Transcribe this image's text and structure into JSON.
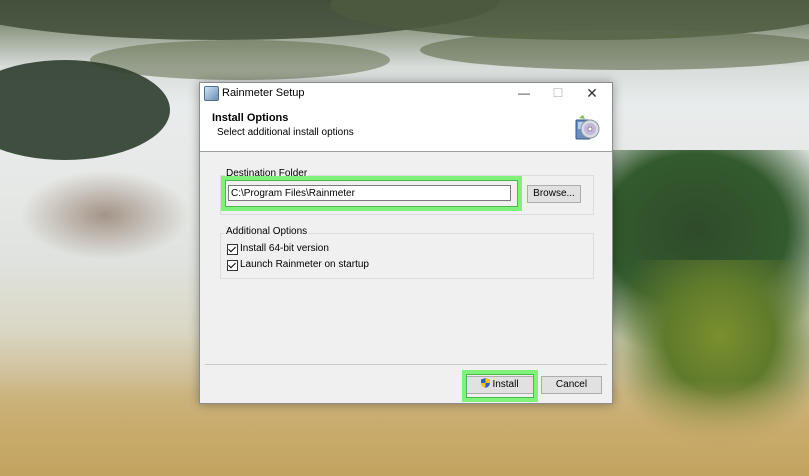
{
  "window": {
    "title": "Rainmeter Setup",
    "min_glyph": "—",
    "max_glyph": "☐",
    "close_glyph": "✕"
  },
  "header": {
    "title": "Install Options",
    "subtitle": "Select additional install options",
    "icon": "installer-disc-icon"
  },
  "destination": {
    "group_label": "Destination Folder",
    "path_value": "C:\\Program Files\\Rainmeter",
    "browse_label": "Browse..."
  },
  "options": {
    "group_label": "Additional Options",
    "items": [
      {
        "label": "Install 64-bit version",
        "checked": true
      },
      {
        "label": "Launch Rainmeter on startup",
        "checked": true
      }
    ]
  },
  "footer": {
    "install_label": "Install",
    "cancel_label": "Cancel"
  },
  "colors": {
    "highlight": "#7ef27a",
    "dialog_bg": "#f0f0f0"
  }
}
